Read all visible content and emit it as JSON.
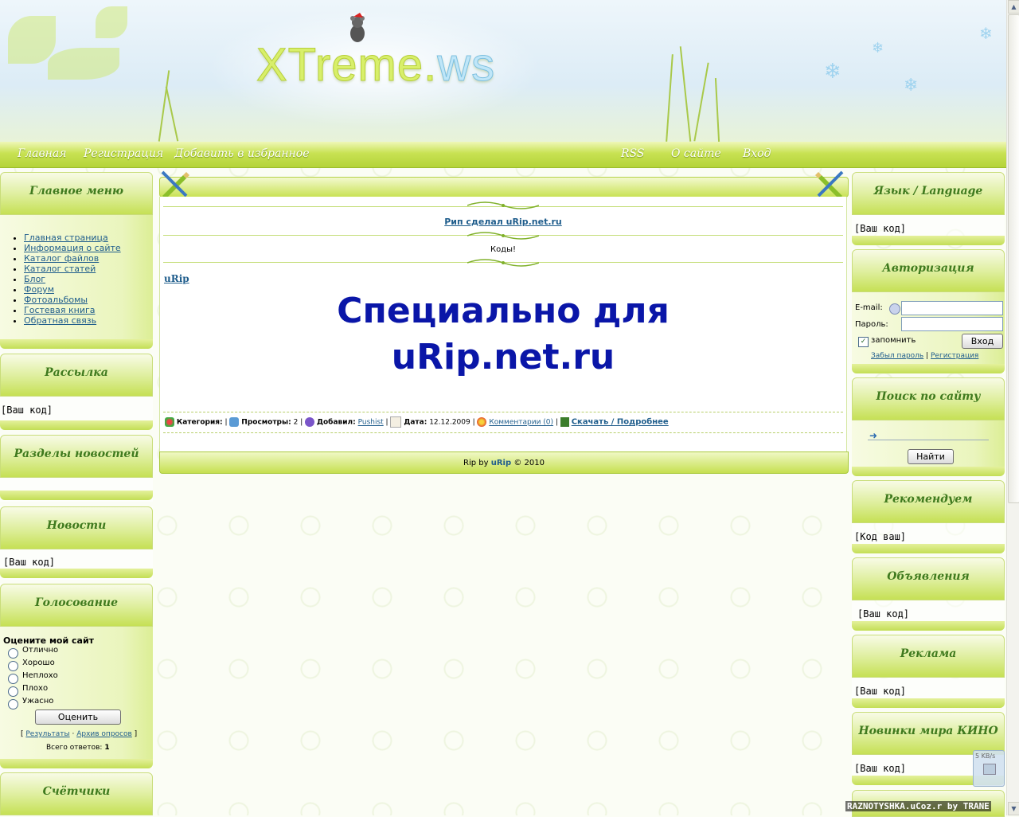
{
  "header": {
    "logo_main": "XTreme.",
    "logo_tld": "ws"
  },
  "nav": {
    "left": [
      "Главная",
      "Регистрация",
      "Добавить в избранное"
    ],
    "right": [
      "RSS",
      "О сайте",
      "Вход"
    ]
  },
  "left": {
    "main_menu": {
      "title": "Главное меню",
      "items": [
        "Главная страница",
        "Информация о сайте",
        "Каталог файлов",
        "Каталог статей",
        "Блог",
        "Форум",
        "Фотоальбомы",
        "Гостевая книга",
        "Обратная связь"
      ]
    },
    "mailing": {
      "title": "Рассылка",
      "body": "[Ваш код]"
    },
    "news_sections": {
      "title": "Разделы новостей"
    },
    "news": {
      "title": "Новости",
      "body": "[Ваш код]"
    },
    "poll": {
      "title": "Голосование",
      "question": "Оцените мой сайт",
      "options": [
        "Отлично",
        "Хорошо",
        "Неплохо",
        "Плохо",
        "Ужасно"
      ],
      "vote_button": "Оценить",
      "results_link": "Результаты",
      "archive_link": "Архив опросов",
      "total_label": "Всего ответов:",
      "total_value": "1"
    },
    "counters": {
      "title": "Счётчики"
    }
  },
  "center": {
    "rip_note": "Рип сделал uRip.net.ru",
    "codes": "Коды!",
    "author_link": "uRip",
    "banner_line1": "Специально для",
    "banner_line2": "uRip.net.ru",
    "meta": {
      "category_label": "Категория:",
      "views_label": "Просмотры:",
      "views_value": "2",
      "added_label": "Добавил:",
      "added_value": "Pushist",
      "date_label": "Дата:",
      "date_value": "12.12.2009",
      "comments": "Комментарии (0)",
      "download": "Скачать / Подробнее"
    },
    "footer_pre": "Rip by ",
    "footer_link": "uRip",
    "footer_post": " © 2010"
  },
  "right": {
    "language": {
      "title": "Язык / Language",
      "body": "[Ваш код]"
    },
    "auth": {
      "title": "Авторизация",
      "email_label": "E-mail:",
      "password_label": "Пароль:",
      "remember_label": "запомнить",
      "login_button": "Вход",
      "forgot_link": "Забыл пароль",
      "register_link": "Регистрация"
    },
    "search": {
      "title": "Поиск по сайту",
      "button": "Найти"
    },
    "recommend": {
      "title": "Рекомендуем",
      "body": "[Код ваш]"
    },
    "ads": {
      "title": "Объявления",
      "body": "[Ваш код]"
    },
    "promo": {
      "title": "Реклама",
      "body": "[Ваш код]"
    },
    "movies": {
      "title": "Новинки мира КИНО",
      "body": "[Ваш код]"
    }
  },
  "tray": {
    "speed": "5 KB/s",
    "watermark": "RAZNOTYSHKA.uCoz.r by TRANE"
  },
  "colors": {
    "accent_green": "#c6e054",
    "link_blue": "#1f5d8c",
    "banner_blue": "#0a16a8",
    "title_green": "#3f7a1e"
  }
}
